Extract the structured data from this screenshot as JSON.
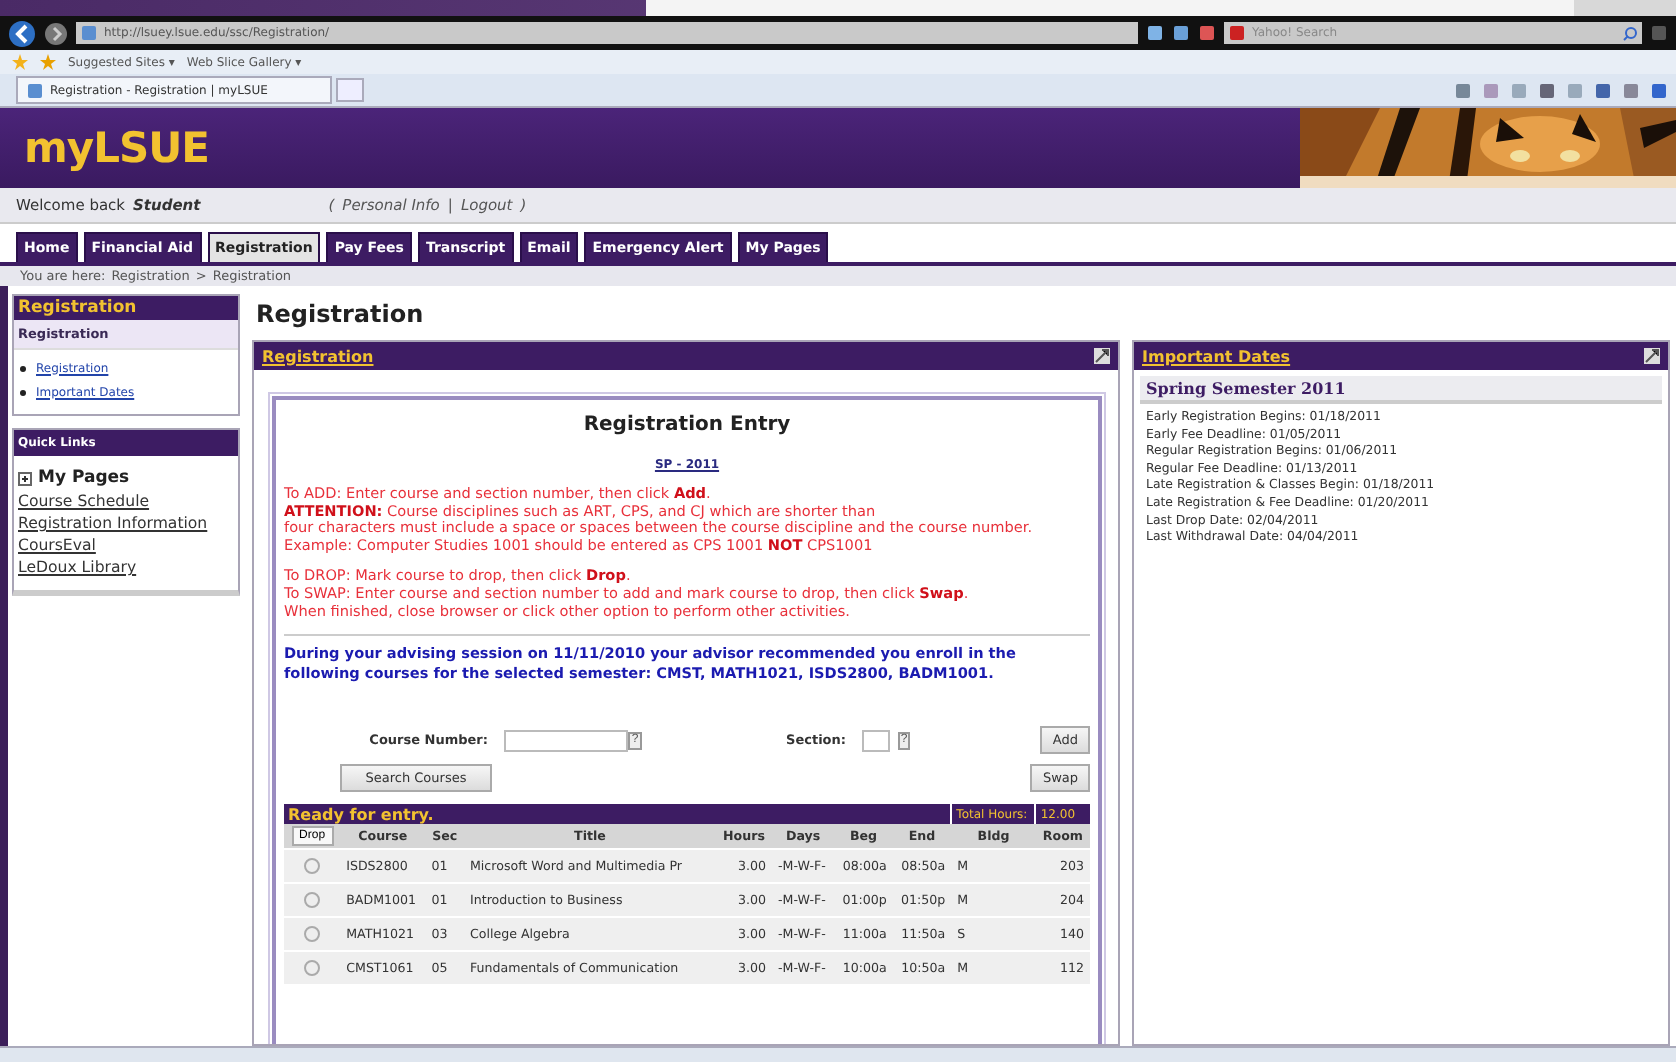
{
  "browser": {
    "address": "http://lsuey.lsue.edu/ssc/Registration/",
    "search_placeholder": "Yahoo! Search",
    "favorites": [
      "Suggested Sites ▾",
      "Web Slice Gallery ▾"
    ],
    "tab_title": "Registration - Registration | myLSUE"
  },
  "header": {
    "logo": "myLSUE"
  },
  "welcome": {
    "greeting": "Welcome back",
    "user": "Student",
    "open": "(",
    "links": [
      "Personal Info",
      "Logout"
    ],
    "separator": "|",
    "close": ")"
  },
  "nav_tabs": [
    {
      "label": "Home",
      "selected": false
    },
    {
      "label": "Financial Aid",
      "selected": false
    },
    {
      "label": "Registration",
      "selected": true
    },
    {
      "label": "Pay Fees",
      "selected": false
    },
    {
      "label": "Transcript",
      "selected": false
    },
    {
      "label": "Email",
      "selected": false
    },
    {
      "label": "Emergency Alert",
      "selected": false
    },
    {
      "label": "My Pages",
      "selected": false
    }
  ],
  "breadcrumb": {
    "prefix": "You are here:",
    "items": [
      "Registration",
      "Registration"
    ],
    "separator": ">"
  },
  "sidebar": {
    "title": "Registration",
    "subtitle": "Registration",
    "links": [
      "Registration",
      "Important Dates"
    ]
  },
  "quick_links": {
    "title": "Quick Links",
    "group": "My Pages",
    "links": [
      "Course Schedule",
      "Registration Information",
      "CoursEval",
      "LeDoux Library"
    ]
  },
  "main": {
    "title": "Registration",
    "panel_title": "Registration",
    "entry": {
      "title": "Registration Entry",
      "term": "SP - 2011",
      "paragraphs": [
        [
          "To ADD: Enter course and section number, then click **Add**.",
          "**ATTENTION:** Course disciplines such as ART, CPS, and CJ which are shorter than",
          "four characters must include a space or spaces between the course discipline and the course number.",
          "Example: Computer Studies 1001 should be entered as CPS 1001 **NOT** CPS1001"
        ],
        [
          "To DROP: Mark course to drop, then click **Drop**.",
          "To SWAP: Enter course and section number to add and mark course to drop, then click **Swap**.",
          "When finished, close browser or click other option to perform other activities."
        ]
      ],
      "advisor_note": "During your advising session on 11/11/2010 your advisor recommended you enroll in the following courses for the selected semester: CMST, MATH1021, ISDS2800, BADM1001.",
      "form": {
        "course_label": "Course Number:",
        "section_label": "Section:",
        "help": "?",
        "add": "Add",
        "swap": "Swap",
        "search": "Search Courses"
      },
      "table": {
        "status": "Ready for entry.",
        "total_label": "Total Hours:",
        "total": "12.00",
        "drop": "Drop",
        "columns": [
          "Course",
          "Sec",
          "Title",
          "Hours",
          "Days",
          "Beg",
          "End",
          "Bldg",
          "Room"
        ],
        "rows": [
          {
            "selected": false,
            "cells": [
              "ISDS2800",
              "01",
              "Microsoft Word and Multimedia Pr",
              "3.00",
              "-M-W-F-",
              "08:00a",
              "08:50a",
              "M",
              "203"
            ]
          },
          {
            "selected": false,
            "cells": [
              "BADM1001",
              "01",
              "Introduction to Business",
              "3.00",
              "-M-W-F-",
              "01:00p",
              "01:50p",
              "M",
              "204"
            ]
          },
          {
            "selected": false,
            "cells": [
              "MATH1021",
              "03",
              "College Algebra",
              "3.00",
              "-M-W-F-",
              "11:00a",
              "11:50a",
              "S",
              "140"
            ]
          },
          {
            "selected": false,
            "cells": [
              "CMST1061",
              "05",
              "Fundamentals of Communication",
              "3.00",
              "-M-W-F-",
              "10:00a",
              "10:50a",
              "M",
              "112"
            ]
          }
        ]
      }
    }
  },
  "important_dates": {
    "title": "Important Dates",
    "semester": "Spring Semester 2011",
    "dates": [
      "Early Registration Begins: 01/18/2011",
      "Early Fee Deadline: 01/05/2011",
      "Regular Registration Begins: 01/06/2011",
      "Regular Fee Deadline: 01/13/2011",
      "Late Registration & Classes Begin: 01/18/2011",
      "Late Registration & Fee Deadline: 01/20/2011",
      "Last Drop Date: 02/04/2011",
      "Last Withdrawal Date: 04/04/2011"
    ]
  }
}
